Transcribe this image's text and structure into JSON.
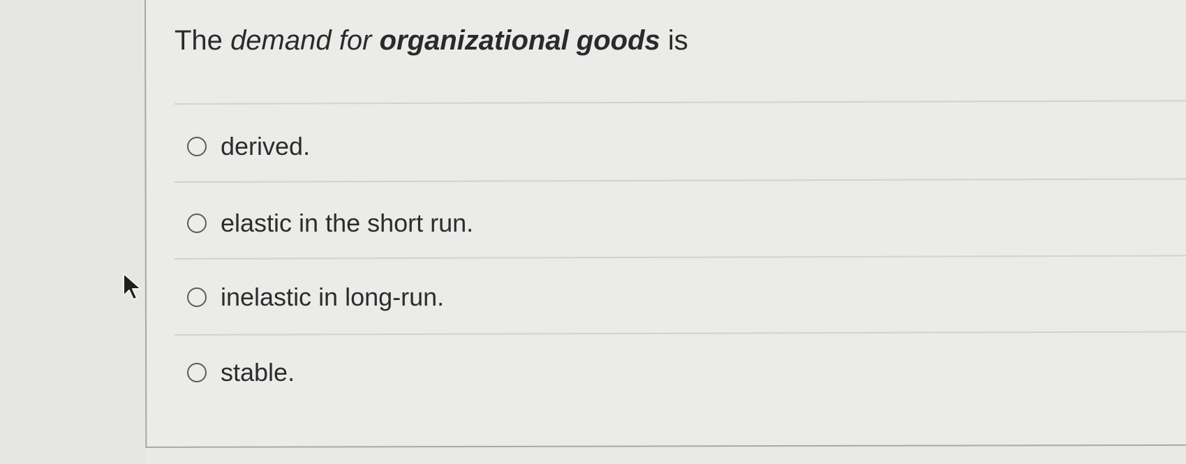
{
  "question": {
    "lead": "The",
    "demand_word": "demand",
    "for_word": "for",
    "subject": "organizational goods",
    "tail": "is"
  },
  "options": [
    {
      "label": "derived."
    },
    {
      "label": "elastic in the short run."
    },
    {
      "label": "inelastic in long-run."
    },
    {
      "label": "stable."
    }
  ],
  "colors": {
    "background": "#e9e9e7",
    "panel": "#ebebe9",
    "text": "#2b2b2b",
    "divider": "#d2d2cf",
    "radio_border": "#5b5b5b"
  },
  "icons": {
    "radio": "radio-circle-icon",
    "pointer": "mouse-pointer-icon"
  }
}
